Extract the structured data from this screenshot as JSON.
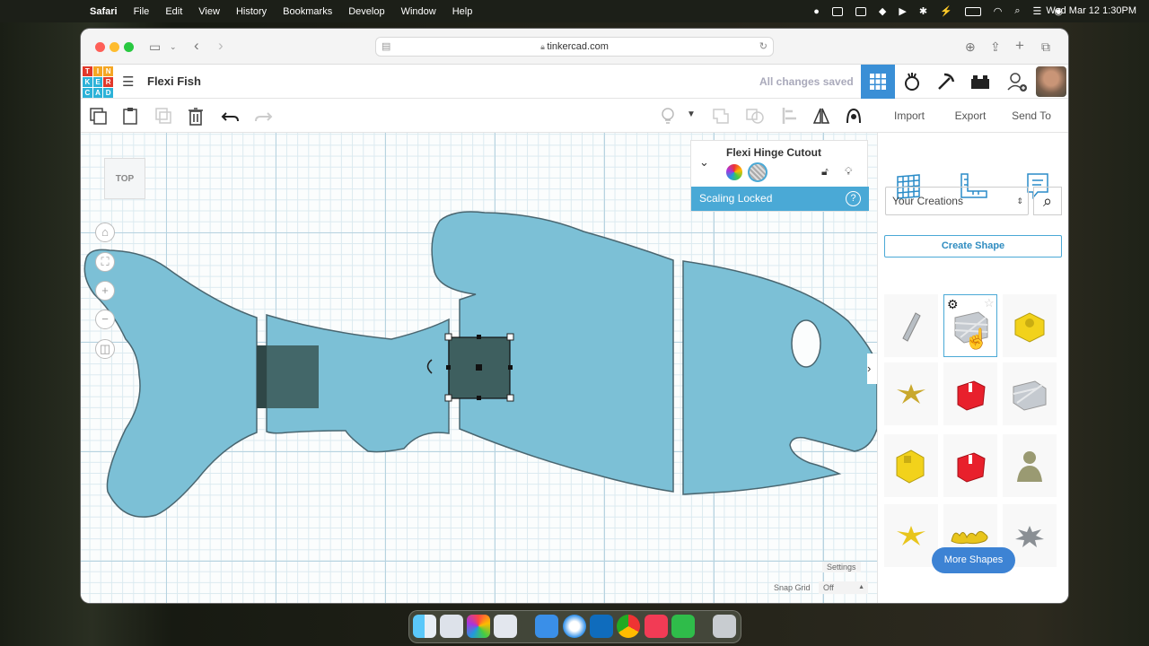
{
  "menubar": {
    "app": "Safari",
    "items": [
      "File",
      "Edit",
      "View",
      "History",
      "Bookmarks",
      "Develop",
      "Window",
      "Help"
    ],
    "clock": "Wed Mar 12  1:30PM"
  },
  "browser": {
    "url": "tinkercad.com"
  },
  "tinkercad": {
    "logo_letters": [
      "T",
      "I",
      "N",
      "K",
      "E",
      "R",
      "C",
      "A",
      "D"
    ],
    "logo_colors": [
      "#e2382a",
      "#f5a623",
      "#f5a623",
      "#2cb2d8",
      "#2cb2d8",
      "#e2382a",
      "#2cb2d8",
      "#2cb2d8",
      "#2cb2d8"
    ],
    "design_title": "Flexi Fish",
    "save_status": "All changes saved",
    "accent_color": "#3a8fd6"
  },
  "toolbar": {
    "import_label": "Import",
    "export_label": "Export",
    "send_to_label": "Send To"
  },
  "workplane": {
    "view_cube_label": "TOP",
    "settings_label": "Settings",
    "snap_grid_label": "Snap Grid",
    "snap_grid_value": "Off",
    "shape_color": "#7cc0d6",
    "hole_color": "#3e5f5f"
  },
  "inspector": {
    "shape_name": "Flexi Hinge Cutout",
    "scaling_message": "Scaling Locked"
  },
  "panel": {
    "library_select": "Your Creations",
    "create_shape_label": "Create Shape",
    "more_shapes_label": "More Shapes",
    "shapes": [
      "stick",
      "hole-box",
      "yellow-part",
      "starfish",
      "red-part",
      "striped-box",
      "yellow-part",
      "red-part",
      "figurine",
      "starfish",
      "text-shape",
      "gear-star"
    ]
  }
}
